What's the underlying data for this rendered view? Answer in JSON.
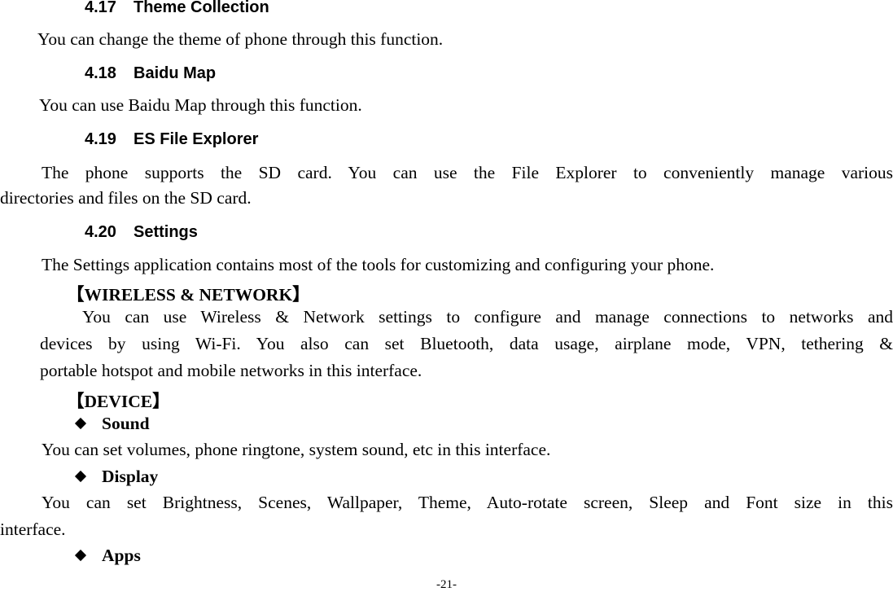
{
  "sections": [
    {
      "number": "4.17",
      "title": "Theme Collection",
      "body": [
        "You can change the theme of phone through this function."
      ]
    },
    {
      "number": "4.18",
      "title": "Baidu Map",
      "body": [
        "You can use Baidu Map through this function."
      ]
    },
    {
      "number": "4.19",
      "title": "ES File Explorer",
      "body": [
        "The phone supports the SD card. You can use the File Explorer to conveniently manage various",
        "directories and files on the SD card."
      ]
    },
    {
      "number": "4.20",
      "title": "Settings",
      "body": [
        "The Settings application contains most of the tools for customizing and configuring your phone."
      ]
    }
  ],
  "wireless": {
    "heading": "【WIRELESS & NETWORK】",
    "body": [
      "You can use Wireless & Network settings to configure and manage connections to networks and",
      "devices by using Wi-Fi. You also can set Bluetooth, data usage, airplane mode, VPN, tethering &",
      "portable hotspot and mobile networks in this interface."
    ]
  },
  "device": {
    "heading": "【DEVICE】",
    "items": [
      {
        "bullet_icon": "diamond",
        "title": "Sound",
        "body": [
          "You can set volumes, phone ringtone, system sound, etc in this interface."
        ]
      },
      {
        "bullet_icon": "diamond",
        "title": "Display",
        "body": [
          "You can set Brightness, Scenes, Wallpaper, Theme, Auto-rotate screen, Sleep and Font size in this",
          "interface."
        ]
      },
      {
        "bullet_icon": "diamond",
        "title": "Apps",
        "body": []
      }
    ]
  },
  "footer": {
    "page_number": "-21-"
  }
}
